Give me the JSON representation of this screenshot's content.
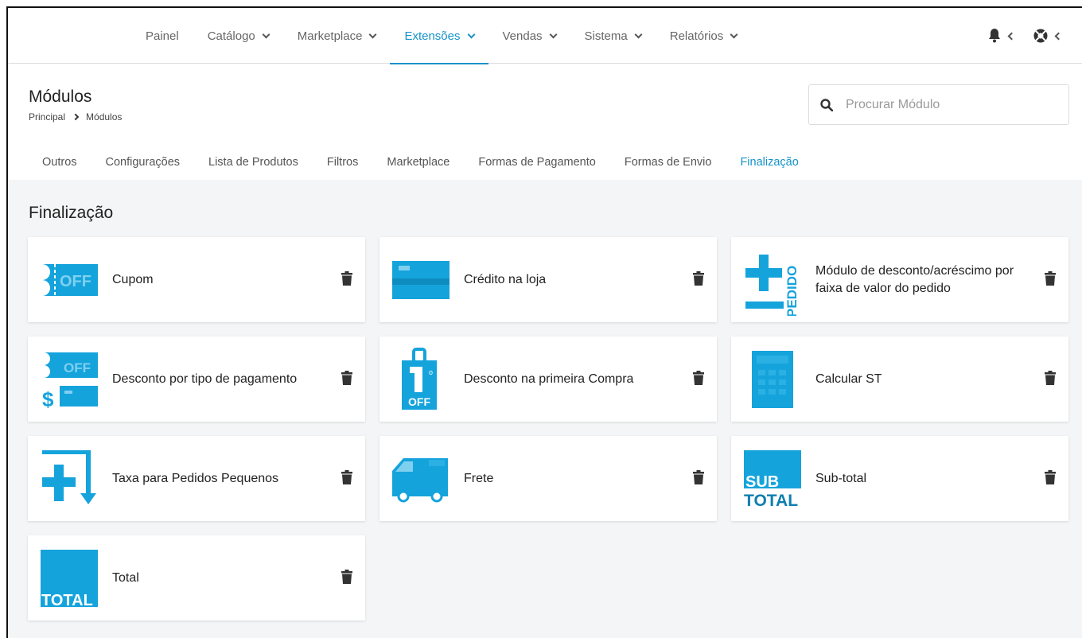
{
  "nav": {
    "items": [
      {
        "label": "Painel",
        "dropdown": false
      },
      {
        "label": "Catálogo",
        "dropdown": true
      },
      {
        "label": "Marketplace",
        "dropdown": true
      },
      {
        "label": "Extensões",
        "dropdown": true,
        "active": true
      },
      {
        "label": "Vendas",
        "dropdown": true
      },
      {
        "label": "Sistema",
        "dropdown": true
      },
      {
        "label": "Relatórios",
        "dropdown": true
      }
    ],
    "icons": [
      "bell-icon",
      "help-icon"
    ]
  },
  "header": {
    "title": "Módulos",
    "breadcrumb": [
      "Principal",
      "Módulos"
    ]
  },
  "search": {
    "placeholder": "Procurar Módulo"
  },
  "tabs": [
    "Outros",
    "Configurações",
    "Lista de Produtos",
    "Filtros",
    "Marketplace",
    "Formas de Pagamento",
    "Formas de Envio",
    "Finalização"
  ],
  "active_tab": "Finalização",
  "section": {
    "title": "Finalização"
  },
  "modules": [
    {
      "name": "Cupom",
      "icon": "coupon-off-icon"
    },
    {
      "name": "Crédito na loja",
      "icon": "credit-card-icon"
    },
    {
      "name": "Módulo de desconto/acréscimo por faixa de valor do pedido",
      "icon": "plus-minus-pedido-icon",
      "icon_text": "PEDIDO"
    },
    {
      "name": "Desconto por tipo de pagamento",
      "icon": "payment-discount-icon"
    },
    {
      "name": "Desconto na primeira Compra",
      "icon": "first-purchase-bag-icon"
    },
    {
      "name": "Calcular ST",
      "icon": "calculator-icon"
    },
    {
      "name": "Taxa para Pedidos Pequenos",
      "icon": "small-order-fee-icon"
    },
    {
      "name": "Frete",
      "icon": "truck-icon"
    },
    {
      "name": "Sub-total",
      "icon": "subtotal-icon",
      "icon_text": "SUB TOTAL"
    },
    {
      "name": "Total",
      "icon": "total-icon",
      "icon_text": "TOTAL"
    }
  ],
  "colors": {
    "accent": "#1593c9",
    "icon_blue": "#15a3dc",
    "background": "#f4f5f7"
  }
}
